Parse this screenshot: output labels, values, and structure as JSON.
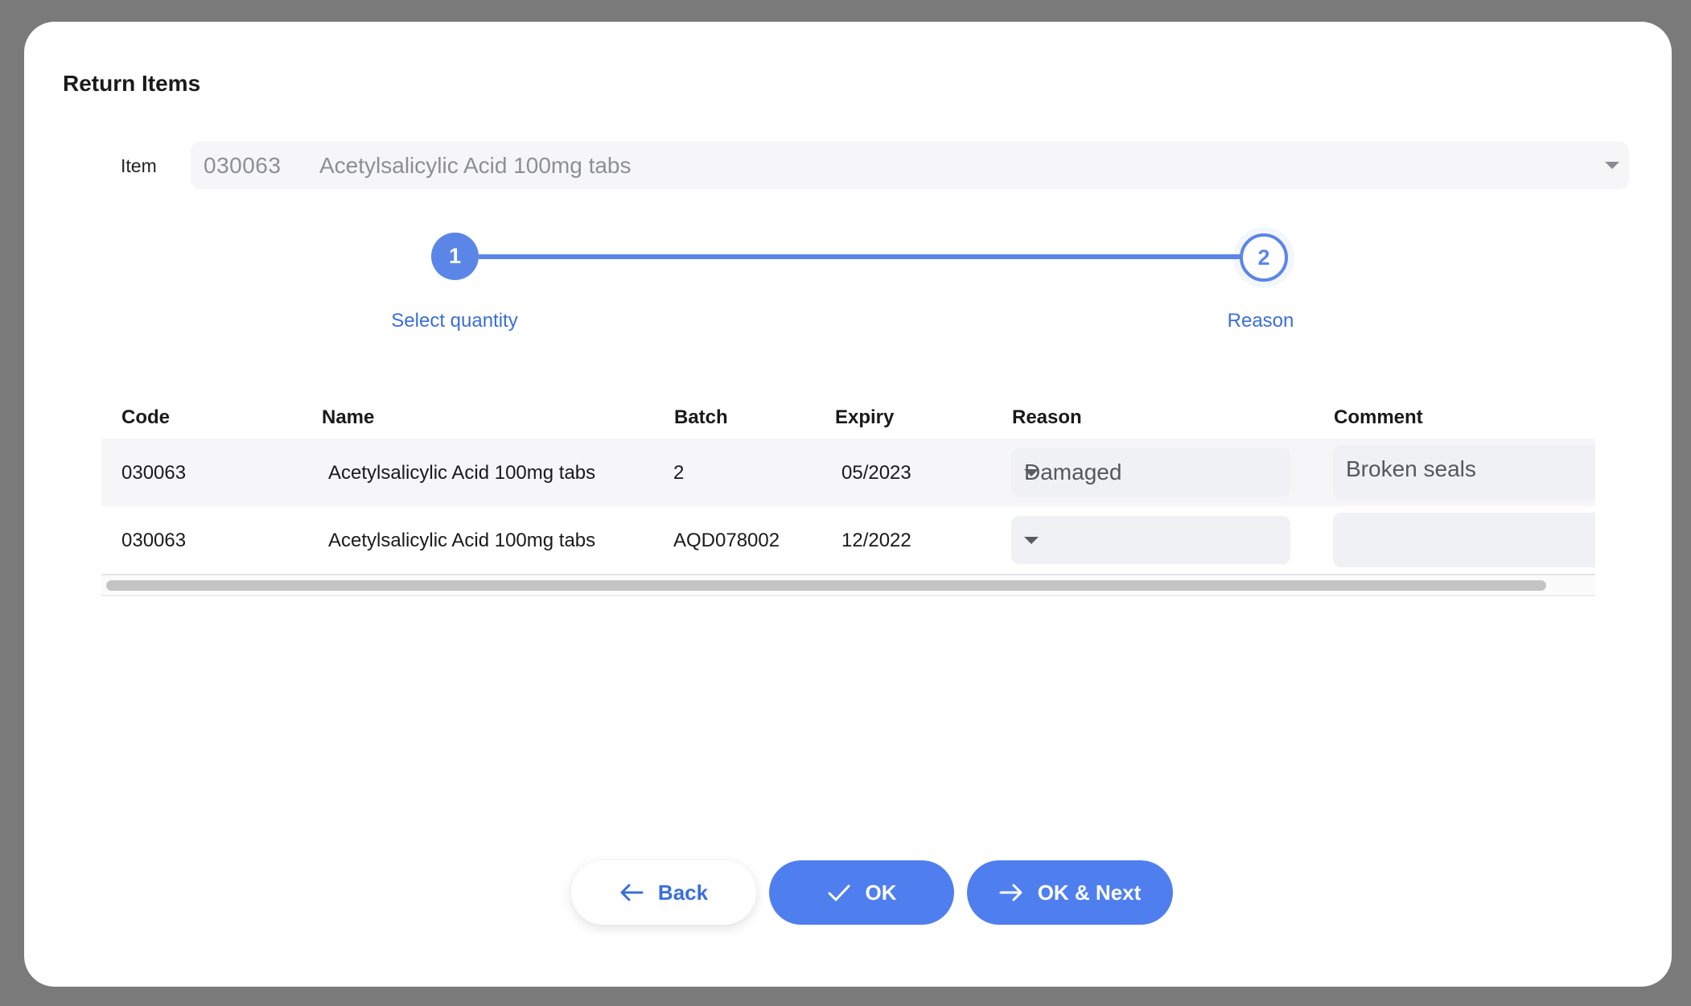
{
  "dialog": {
    "title": "Return Items"
  },
  "item": {
    "label": "Item",
    "code": "030063",
    "name": "Acetylsalicylic Acid 100mg tabs"
  },
  "steps": [
    {
      "number": "1",
      "label": "Select quantity"
    },
    {
      "number": "2",
      "label": "Reason"
    }
  ],
  "table": {
    "headers": {
      "code": "Code",
      "name": "Name",
      "batch": "Batch",
      "expiry": "Expiry",
      "reason": "Reason",
      "comment": "Comment"
    },
    "rows": [
      {
        "code": "030063",
        "name": "Acetylsalicylic Acid 100mg tabs",
        "batch": "2",
        "expiry": "05/2023",
        "reason": "Damaged",
        "comment": "Broken seals"
      },
      {
        "code": "030063",
        "name": "Acetylsalicylic Acid 100mg tabs",
        "batch": "AQD078002",
        "expiry": "12/2022",
        "reason": "",
        "comment": ""
      }
    ]
  },
  "buttons": {
    "back": "Back",
    "ok": "OK",
    "ok_next": "OK & Next"
  },
  "colors": {
    "accent": "#4f7fef",
    "step": "#5b86e8",
    "backdrop": "#7a7a7a"
  },
  "icons": {
    "back": "arrow-left-icon",
    "ok": "check-icon",
    "ok_next": "arrow-right-icon",
    "dropdown": "caret-down-icon"
  }
}
